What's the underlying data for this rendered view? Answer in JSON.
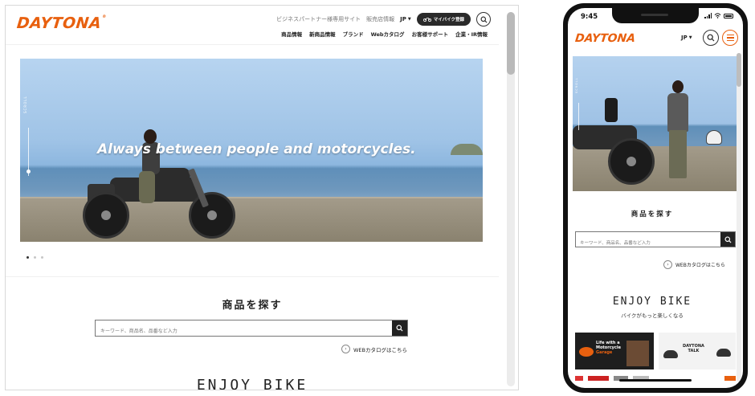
{
  "desktop": {
    "logo": "DAYTONA",
    "top_links": [
      "ビジネスパートナー様専用サイト",
      "販売店情報"
    ],
    "lang": "JP",
    "mybike_label": "マイバイク登録",
    "nav": [
      "商品情報",
      "新商品情報",
      "ブランド",
      "Webカタログ",
      "お客様サポート",
      "企業・IR情報"
    ],
    "hero": {
      "tagline": "Always between people and motorcycles.",
      "scroll_label": "SCROLL"
    },
    "slider_dots": 3,
    "find_title": "商品を探す",
    "search_placeholder": "キーワード、商品名、品番など入力",
    "catalog_link": "WEBカタログはこちら",
    "enjoy_title": "ENJOY BIKE"
  },
  "mobile": {
    "time": "9:45",
    "logo": "DAYTONA",
    "lang": "JP",
    "hero": {
      "scroll_label": "SCROLL"
    },
    "find_title": "商品を探す",
    "search_placeholder": "キーワード、商品名、品番など入力",
    "catalog_link": "WEBカタログはこちら",
    "enjoy_title": "ENJOY BIKE",
    "enjoy_subtitle": "バイクがもっと楽しくなる",
    "card1": {
      "line1": "Life with a",
      "line2": "Motorcycle",
      "line3": "Garage"
    },
    "card2": {
      "line1": "DAYTONA",
      "line2": "TALK"
    }
  },
  "colors": {
    "brand_orange": "#e8600f",
    "dark": "#222222"
  },
  "icons": [
    "search-icon",
    "caret-down-icon",
    "bike-icon",
    "hamburger-menu-icon",
    "chevron-right-icon"
  ]
}
